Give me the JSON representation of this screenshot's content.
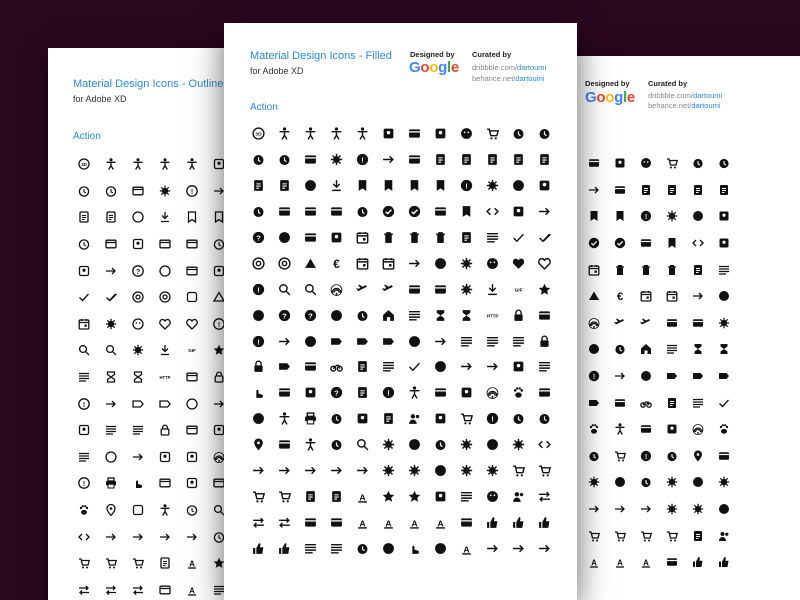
{
  "colors": {
    "background": "#2c0820",
    "accent": "#2b8ae6",
    "icon": "#111111"
  },
  "left_sheet": {
    "title": "Material Design Icons - Outlined",
    "subtitle": "for Adobe XD",
    "section": "Action",
    "icons": [
      "3d-rotation",
      "accessibility",
      "accessibility-new",
      "accessible",
      "accessible-forward",
      "account-balance",
      "alarm-off",
      "alarm",
      "all-out",
      "android-outlined",
      "announcement",
      "arrow-right-alt",
      "assignment-returned",
      "assignment-turned-in",
      "autorenew",
      "backup",
      "book",
      "bookmark",
      "calendar-today",
      "card-giftcard",
      "camera-enhance",
      "card-membership",
      "card-travel",
      "change-history",
      "commute",
      "compare-arrows",
      "contact-support",
      "copyright",
      "credit-card",
      "dashboard",
      "done",
      "done-all",
      "donut-large",
      "donut-small",
      "drag-indicator",
      "eject",
      "event-busy",
      "extension",
      "face",
      "favorite",
      "favorite-border",
      "feedback",
      "find-in-page",
      "find-replace",
      "gavel",
      "get-app",
      "gif",
      "grade",
      "list",
      "hourglass-empty",
      "hourglass-full",
      "http",
      "important-devices",
      "lock",
      "info",
      "input",
      "label",
      "label-important",
      "language",
      "launch",
      "lightbulb",
      "line-style",
      "line-weight",
      "lock-open",
      "markunread-mailbox",
      "minimize",
      "offline-bolt",
      "opacity",
      "open-in-new",
      "open-with",
      "perm-phone-msg",
      "perm-scan-wifi",
      "perm-device-information",
      "print",
      "pan-tool",
      "payment",
      "phone-in-talk",
      "picture-in-picture",
      "pets",
      "place",
      "photo-size-select",
      "pregnant",
      "query-builder",
      "search",
      "settings-ethernet",
      "settings-input-antenna",
      "settings-input-component",
      "settings-input-hdmi",
      "settings-input-svideo",
      "settings-backup-restore",
      "shop",
      "shopping-basket",
      "shopping-cart",
      "speaker-notes",
      "spellcheck",
      "star-rate",
      "swap-horiz",
      "swap-vert",
      "swap-vertical-circle",
      "table",
      "text-rotate-up",
      "toc"
    ]
  },
  "center_sheet": {
    "title": "Material Design Icons - Filled",
    "subtitle": "for Adobe XD",
    "designed_by_label": "Designed by",
    "designed_by_brand": "Google",
    "curated_by_label": "Curated by",
    "curated_line1_prefix": "dribbble.com/",
    "curated_line1_handle": "dartoumi",
    "curated_line2_prefix": "behance.net/",
    "curated_line2_handle": "dartoumi",
    "section": "Action",
    "icons": [
      "3d-rotation",
      "accessibility",
      "accessibility-new",
      "accessible",
      "accessible-forward",
      "account-balance",
      "account-balance-wallet",
      "account-box",
      "account-circle",
      "add-shopping-cart",
      "alarm",
      "alarm-add",
      "alarm-off",
      "alarm-on",
      "all-inbox",
      "android",
      "announcement",
      "arrow-right-alt",
      "aspect-ratio",
      "assessment",
      "assignment",
      "assignment-ind",
      "assignment-late",
      "assignment-return",
      "assignment-returned",
      "assignment-turned-in",
      "autorenew",
      "backup",
      "book",
      "bookmark",
      "bookmark-border",
      "bookmarks",
      "bug-report",
      "build",
      "cached",
      "camera-enhance",
      "calendar-today",
      "card-giftcard",
      "card-membership",
      "card-travel",
      "change-history",
      "check-circle",
      "check-circle-outline",
      "chrome-reader-mode",
      "class",
      "code",
      "commute",
      "compare-arrows",
      "contact-support",
      "copyright",
      "credit-card",
      "dashboard",
      "date-range",
      "delete",
      "delete-forever",
      "delete-outline",
      "description",
      "dns",
      "done",
      "done-all",
      "donut-large",
      "donut-small",
      "eject",
      "euro",
      "event",
      "event-seat",
      "exit-to-app",
      "explore",
      "extension",
      "face",
      "favorite",
      "favorite-border",
      "feedback",
      "find-in-page",
      "find-replace",
      "fingerprint",
      "flight-land",
      "flight-takeoff",
      "flip-to-back",
      "flip-to-front",
      "gavel",
      "get-app",
      "gif",
      "grade",
      "group-work",
      "help",
      "help-outline",
      "highlight-off",
      "history",
      "home",
      "horizontal-split",
      "hourglass-empty",
      "hourglass-full",
      "http",
      "https",
      "important-devices",
      "info",
      "input",
      "invert-colors",
      "label",
      "label-important",
      "label-off",
      "language",
      "launch",
      "line-style",
      "line-weight",
      "list",
      "lock",
      "lock-open",
      "loyalty",
      "markunread-mailbox",
      "motorcycle",
      "note-add",
      "offline-bolt",
      "offline-pin",
      "opacity",
      "open-in-browser",
      "open-in-new",
      "open-with",
      "outline",
      "pan-tool",
      "payment",
      "perm-camera-mic",
      "perm-contact-calendar",
      "perm-data-setting",
      "perm-device-information",
      "perm-identity",
      "perm-media",
      "perm-phone-msg",
      "perm-scan-wifi",
      "pets",
      "picture-in-picture",
      "power-settings-new",
      "pregnant-woman",
      "print",
      "query-builder",
      "question-answer",
      "receipt",
      "record-voice-over",
      "redeem",
      "remove-shopping-cart",
      "report-problem",
      "restore",
      "restore-page",
      "room",
      "rounded-corner",
      "rowing",
      "schedule",
      "search",
      "settings",
      "settings-applications",
      "settings-backup-restore",
      "settings-bluetooth",
      "settings-brightness",
      "settings-cell",
      "settings-ethernet",
      "settings-input-antenna",
      "settings-input-component",
      "settings-input-composite",
      "settings-input-hdmi",
      "settings-input-svideo",
      "settings-overscan",
      "settings-phone",
      "settings-power",
      "settings-remote",
      "settings-voice",
      "shop",
      "shop-two",
      "shopping-basket",
      "shopping-cart",
      "speaker-notes",
      "speaker-notes-off",
      "spellcheck",
      "star-rate",
      "stars",
      "store",
      "subject",
      "supervised-user-circle",
      "supervisor-account",
      "swap-horiz",
      "swap-vert",
      "swap-vertical-circle",
      "tab",
      "tab-unselected",
      "text-rotate-up",
      "text-rotate-vertical",
      "text-rotation-down",
      "text-rotation-none",
      "theaters",
      "thumb-down",
      "thumbs-up-down",
      "thumb-up",
      "thumb-up-alt",
      "thumb-down-alt",
      "timeline",
      "toc",
      "today",
      "toll",
      "touch-app",
      "track-changes",
      "translate",
      "trending-down",
      "trending-flat",
      "trending-up"
    ]
  },
  "right_sheet": {
    "designed_by_label": "Designed by",
    "designed_by_brand": "Google",
    "curated_by_label": "Curated by",
    "curated_line1_prefix": "dribbble.com/",
    "curated_line1_handle": "dartoumi",
    "curated_line2_prefix": "behance.net/",
    "curated_line2_handle": "dartoumi",
    "icons": [
      "account-balance-wallet",
      "account-box",
      "account-circle",
      "add-shopping-cart",
      "alarm",
      "alarm-add",
      "arrow-right-alt",
      "aspect-ratio",
      "assessment",
      "assignment",
      "assignment-ind",
      "assignment-late",
      "bookmark-border",
      "bookmarks",
      "bug-report",
      "build",
      "cached",
      "camera-enhance",
      "check-circle",
      "check-circle-outline",
      "chrome-reader-mode",
      "class",
      "code",
      "commute",
      "date-range",
      "delete",
      "delete-forever",
      "delete-outline",
      "description",
      "dns",
      "eject",
      "euro",
      "event",
      "event-seat",
      "exit-to-app",
      "explore",
      "fingerprint",
      "flight-land",
      "flight-takeoff",
      "flip-to-back",
      "flip-to-front",
      "gavel",
      "highlight-off",
      "history",
      "home",
      "horizontal-split",
      "hourglass-empty",
      "hourglass-full",
      "info",
      "input",
      "invert-colors",
      "label",
      "label-important",
      "label-off",
      "loyalty",
      "markunread-mailbox",
      "motorcycle",
      "note-add",
      "offline-bolt",
      "offline-pin",
      "pets",
      "perm-identity",
      "perm-media",
      "perm-phone-msg",
      "perm-scan-wifi",
      "pets",
      "restore",
      "remove-shopping-cart",
      "report-problem",
      "restore-page",
      "room",
      "rounded-corner",
      "settings",
      "settings-applications",
      "settings-backup-restore",
      "settings-bluetooth",
      "settings-brightness",
      "settings-cell",
      "settings-input-composite",
      "settings-input-hdmi",
      "settings-input-svideo",
      "settings-overscan",
      "settings-phone",
      "settings-power",
      "shop",
      "shop-two",
      "shopping-basket",
      "shopping-cart",
      "speaker-notes",
      "supervisor-account",
      "text-rotate-vertical",
      "text-rotation-down",
      "text-rotation-none",
      "theaters",
      "thumb-down",
      "thumbs-up-down"
    ]
  }
}
